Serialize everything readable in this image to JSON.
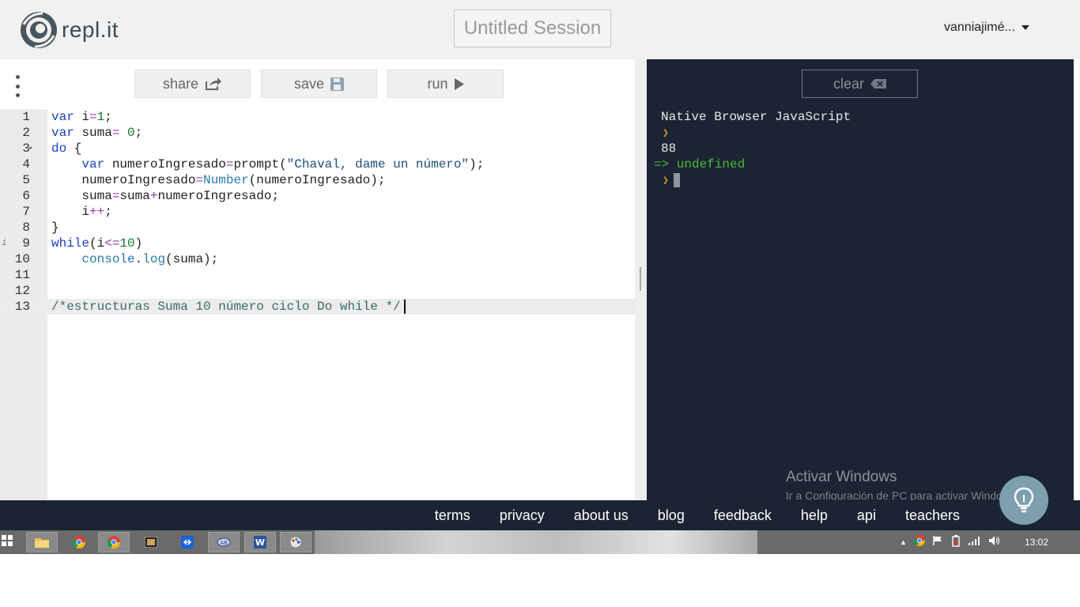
{
  "header": {
    "logo_text": "repl.it",
    "session_title": "Untitled Session",
    "user_name": "vanniajimé..."
  },
  "toolbar": {
    "share_label": "share",
    "save_label": "save",
    "run_label": "run"
  },
  "editor": {
    "active_line": 13,
    "lines": [
      {
        "n": "1",
        "code": "var i=1;"
      },
      {
        "n": "2",
        "code": "var suma= 0;"
      },
      {
        "n": "3",
        "code": "do {"
      },
      {
        "n": "4",
        "code": "    var numeroIngresado=prompt(\"Chaval, dame un número\");"
      },
      {
        "n": "5",
        "code": "    numeroIngresado=Number(numeroIngresado);"
      },
      {
        "n": "6",
        "code": "    suma=suma+numeroIngresado;"
      },
      {
        "n": "7",
        "code": "    i++;"
      },
      {
        "n": "8",
        "code": "}"
      },
      {
        "n": "9",
        "code": "while(i<=10)"
      },
      {
        "n": "10",
        "code": "    console.log(suma);"
      },
      {
        "n": "11",
        "code": ""
      },
      {
        "n": "12",
        "code": ""
      },
      {
        "n": "13",
        "code": "/*estructuras Suma 10 número ciclo Do while */"
      }
    ]
  },
  "console": {
    "clear_label": "clear",
    "header": "Native Browser JavaScript",
    "output_value": "88",
    "result_text": "=> undefined"
  },
  "watermark": {
    "title": "Activar Windows",
    "subtitle": "Ir a Configuración de PC para activar Windows."
  },
  "footer": {
    "links": [
      "terms",
      "privacy",
      "about us",
      "blog",
      "feedback",
      "help",
      "api",
      "teachers"
    ]
  },
  "taskbar": {
    "clock": "13:02"
  },
  "colors": {
    "console_bg": "#1b2433",
    "result_green": "#4ab93a",
    "prompt_orange": "#e0901e",
    "keyword_blue": "#1a3fc4"
  }
}
